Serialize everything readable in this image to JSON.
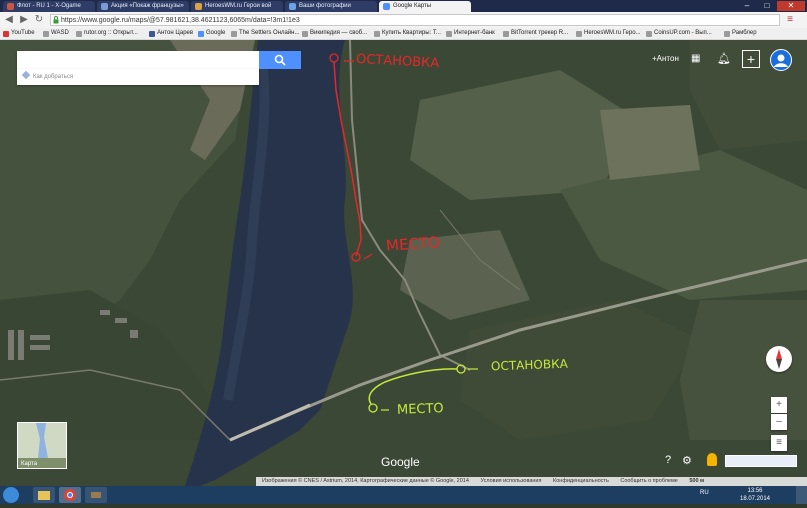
{
  "window": {
    "tabs": [
      {
        "label": "Флот - RU 1 - X-Ogame"
      },
      {
        "label": "Акция «Покаж французы»"
      },
      {
        "label": "HeroesWM.ru Герои вой"
      },
      {
        "label": "Ваши фотографии"
      },
      {
        "label": "Google Карты"
      }
    ],
    "controls": {
      "minimize": "–",
      "maximize": "□",
      "close": "✕"
    }
  },
  "address_bar": {
    "url": "https://www.google.ru/maps/@57.981621,38.4621123,6065m/data=!3m1!1e3"
  },
  "bookmarks": [
    {
      "label": "YouTube"
    },
    {
      "label": "WASD"
    },
    {
      "label": "rutor.org :: Открыт..."
    },
    {
      "label": "Антон Царев"
    },
    {
      "label": "Google"
    },
    {
      "label": "The Settlers Онлайн..."
    },
    {
      "label": "Википедия — своб..."
    },
    {
      "label": "Купить Квартиры: Т..."
    },
    {
      "label": "Интернет-банк"
    },
    {
      "label": "BitTorrent трекер R..."
    },
    {
      "label": "HeroesWM.ru Геро..."
    },
    {
      "label": "CoinsUP.com - Вып..."
    },
    {
      "label": "Рамблер"
    }
  ],
  "maps": {
    "search_value": "",
    "directions_label": "Как добраться",
    "account_name": "+Антон",
    "minimap_label": "Карта",
    "google_logo": "Google",
    "attribution": [
      {
        "text": "Изображения © CNES / Astrium, 2014, Картографические данные © Google, 2014"
      },
      {
        "text": "Условия использования"
      },
      {
        "text": "Конфиденциальность"
      },
      {
        "text": "Сообщить о проблеме"
      },
      {
        "text": "500 м"
      }
    ]
  },
  "annotations": {
    "red_stop": "ОСТАНОВКА",
    "red_place": "МЕСТО",
    "green_stop": "ОСТАНОВКА",
    "green_place": "МЕСТО"
  },
  "taskbar": {
    "language": "RU",
    "time": "13:56",
    "date": "18.07.2014"
  },
  "colors": {
    "annotation_red": "#e8262a",
    "annotation_green": "#c6e83a",
    "maps_blue": "#4d90fe"
  }
}
